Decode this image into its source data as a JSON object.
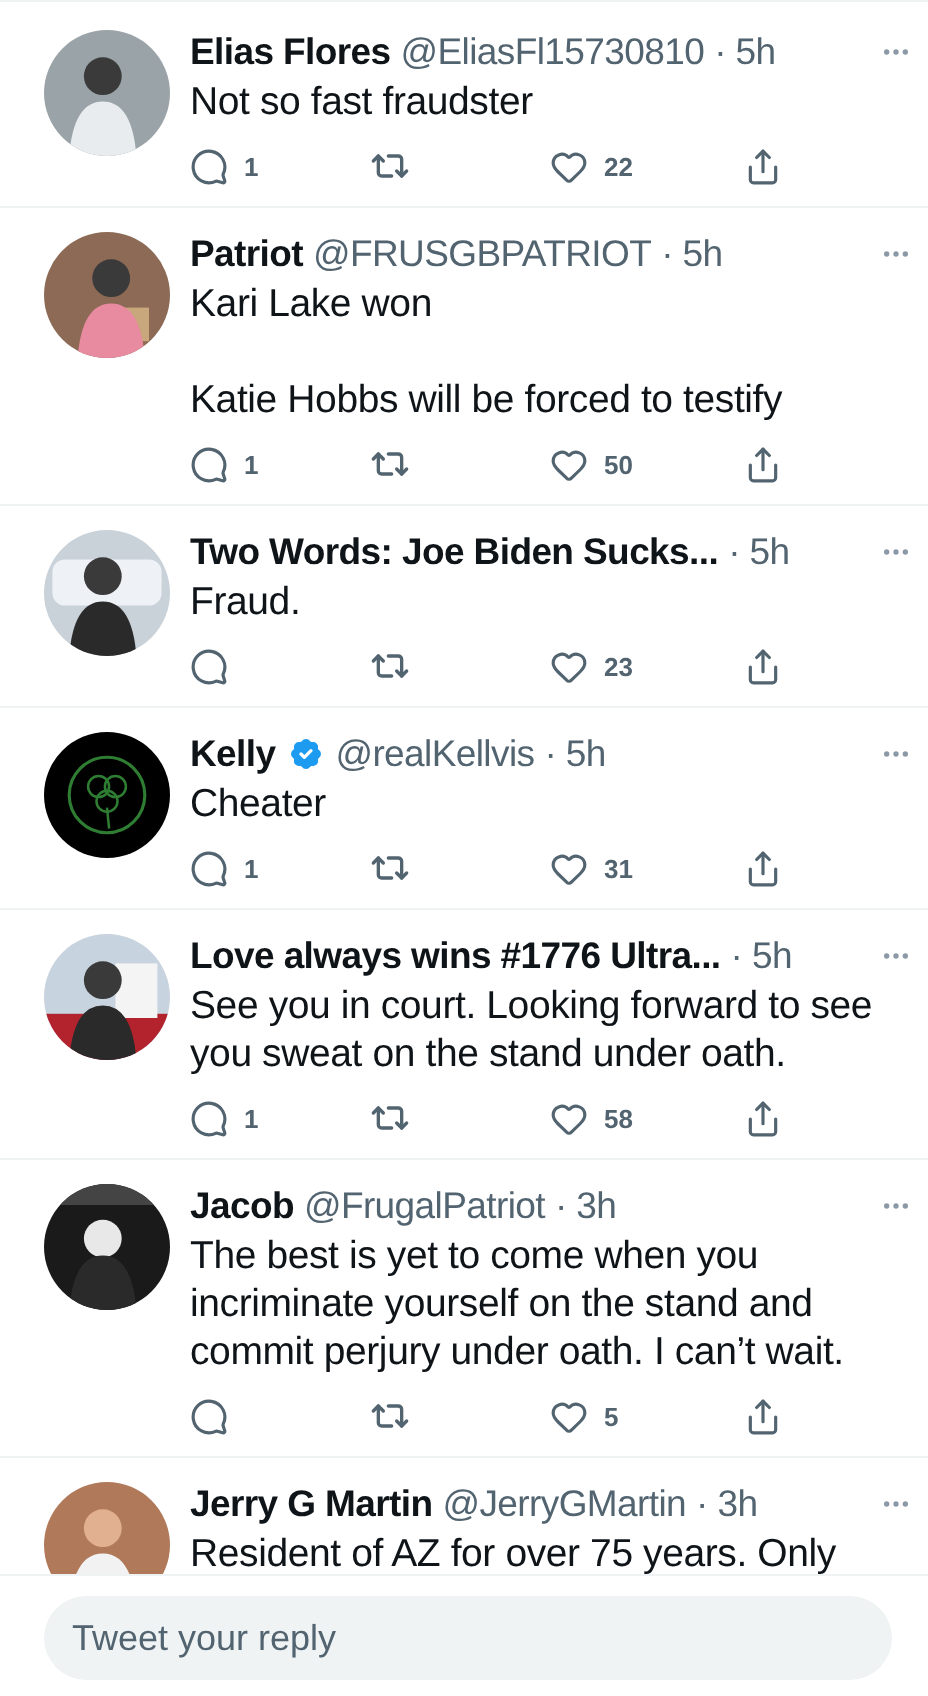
{
  "replies": [
    {
      "name": "Elias Flores",
      "handle": "@EliasFl15730810",
      "time": "· 5h",
      "verified": false,
      "paragraphs": [
        "Not so fast fraudster"
      ],
      "reply_count": "1",
      "like_count": "22"
    },
    {
      "name": "Patriot",
      "handle": "@FRUSGBPATRIOT",
      "time": "· 5h",
      "verified": false,
      "paragraphs": [
        "Kari Lake won",
        "Katie Hobbs will be forced to testify"
      ],
      "reply_count": "1",
      "like_count": "50"
    },
    {
      "name": "Two Words: Joe Biden Sucks...",
      "time": "· 5h",
      "verified": false,
      "paragraphs": [
        "Fraud."
      ],
      "like_count": "23"
    },
    {
      "name": "Kelly",
      "handle": "@realKellvis",
      "time": "· 5h",
      "verified": true,
      "paragraphs": [
        "Cheater"
      ],
      "reply_count": "1",
      "like_count": "31"
    },
    {
      "name": "Love always wins #1776 Ultra...",
      "time": "· 5h",
      "verified": false,
      "paragraphs": [
        "See you in court. Looking forward to see you sweat on the stand under oath."
      ],
      "reply_count": "1",
      "like_count": "58"
    },
    {
      "name": "Jacob",
      "handle": "@FrugalPatriot",
      "time": "· 3h",
      "verified": false,
      "paragraphs": [
        "The best is yet to come when you incriminate yourself on the stand and commit perjury under oath.  I can’t wait."
      ],
      "like_count": "5"
    },
    {
      "name": "Jerry G Martin",
      "handle": "@JerryGMartin",
      "time": "· 3h",
      "verified": false,
      "paragraphs": [
        "Resident of AZ for over 75 years.  Only"
      ]
    }
  ],
  "reply_box": {
    "placeholder": "Tweet your reply"
  }
}
